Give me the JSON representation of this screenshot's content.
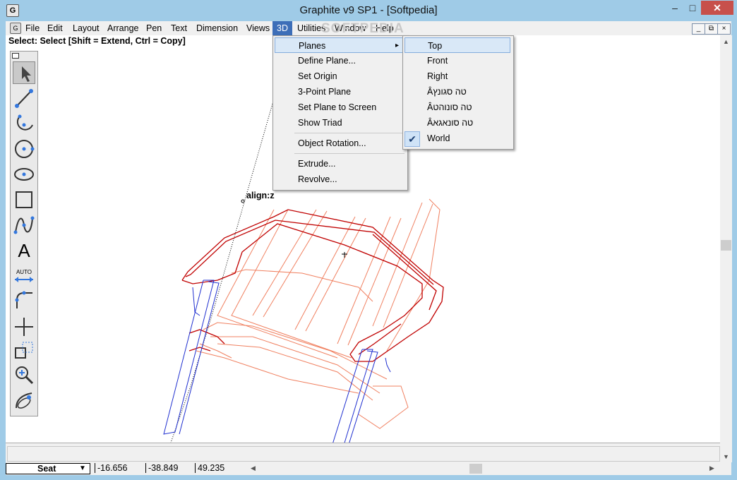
{
  "window": {
    "title": "Graphite v9 SP1 - [Softpedia]",
    "app_icon": "graphite-logo-icon",
    "controls": {
      "minimize": "–",
      "maximize": "□",
      "close": "✕"
    }
  },
  "menubar": {
    "items": [
      "File",
      "Edit",
      "Layout",
      "Arrange",
      "Pen",
      "Text",
      "Dimension",
      "Views",
      "3D",
      "Utilities",
      "Window",
      "Help"
    ],
    "active": "3D",
    "mdi_controls": [
      "_",
      "⧉",
      "×"
    ]
  },
  "watermark": "SOFTPEDIA",
  "status": {
    "text": "Select: Select  [Shift = Extend, Ctrl = Copy]"
  },
  "canvas": {
    "label": "align:z",
    "colors": {
      "dark_red": "#c00000",
      "light_red": "#f08060",
      "blue": "#2030d0"
    }
  },
  "toolbox": {
    "tools": [
      "select-arrow-icon",
      "line-icon",
      "arc-icon",
      "circle-icon",
      "ellipse-icon",
      "rectangle-icon",
      "spline-icon",
      "text-icon",
      "auto-dimension-icon",
      "fillet-icon",
      "crosshair-icon",
      "box-select-icon",
      "zoom-icon",
      "rotate-view-icon"
    ],
    "auto_label": "AUTO",
    "text_tool": "A"
  },
  "menu_3d": {
    "items": [
      {
        "label": "Planes",
        "submenu": true
      },
      {
        "label": "Define Plane..."
      },
      {
        "label": "Set Origin"
      },
      {
        "label": "3-Point Plane"
      },
      {
        "label": "Set Plane to Screen"
      },
      {
        "label": "Show Triad"
      },
      {
        "label": "Object Rotation..."
      },
      {
        "label": "Extrude..."
      },
      {
        "label": "Revolve..."
      }
    ],
    "submenu_arrow": "▸"
  },
  "menu_planes": {
    "items": [
      {
        "label": "Top"
      },
      {
        "label": "Front"
      },
      {
        "label": "Right"
      },
      {
        "label": "Âטה סגונץ"
      },
      {
        "label": "Âטה סונוהט"
      },
      {
        "label": "Âטה סונאגא"
      },
      {
        "label": "World",
        "checked": true
      }
    ],
    "check_mark": "✔"
  },
  "coordbar": {
    "layer": "Seat",
    "dropdown_arrow": "▼",
    "x": "-16.656",
    "y": "-38.849",
    "z": "49.235"
  }
}
